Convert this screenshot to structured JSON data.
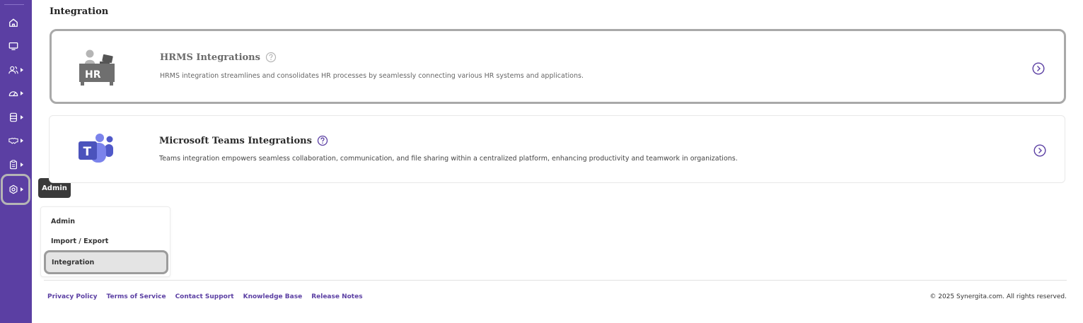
{
  "page": {
    "title": "Integration"
  },
  "sidebar": {
    "items": [
      {
        "icon": "home-icon",
        "has_caret": false
      },
      {
        "icon": "monitor-icon",
        "has_caret": false
      },
      {
        "icon": "users-icon",
        "has_caret": true
      },
      {
        "icon": "gauge-icon",
        "has_caret": true
      },
      {
        "icon": "database-icon",
        "has_caret": true
      },
      {
        "icon": "handshake-icon",
        "has_caret": true
      },
      {
        "icon": "clipboard-icon",
        "has_caret": true
      },
      {
        "icon": "settings-icon",
        "has_caret": true,
        "active": true
      }
    ],
    "tooltip": "Admin",
    "accent": "#5b3fa3"
  },
  "integrations": [
    {
      "title": "HRMS Integrations",
      "description": "HRMS integration streamlines and consolidates HR processes by seamlessly connecting various HR systems and applications.",
      "logo_text": "HR",
      "icon": "hr-desk-icon"
    },
    {
      "title": "Microsoft Teams Integrations",
      "description": "Teams integration empowers seamless collaboration, communication, and file sharing within a centralized platform, enhancing productivity and teamwork in organizations.",
      "logo_text": "T",
      "icon": "microsoft-teams-icon"
    }
  ],
  "admin_menu": {
    "items": [
      "Admin",
      "Import / Export",
      "Integration"
    ],
    "selected": "Integration"
  },
  "footer": {
    "links": [
      "Privacy Policy",
      "Terms of Service",
      "Contact Support",
      "Knowledge Base",
      "Release Notes"
    ],
    "copyright": "© 2025 Synergita.com. All rights reserved."
  }
}
